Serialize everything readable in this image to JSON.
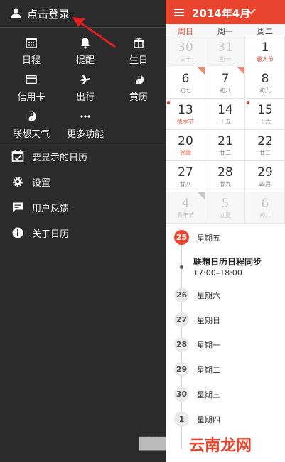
{
  "drawer": {
    "login_label": "点击登录",
    "grid": [
      {
        "label": "日程",
        "icon": "calendar-grid-icon"
      },
      {
        "label": "提醒",
        "icon": "bell-icon"
      },
      {
        "label": "生日",
        "icon": "gift-icon"
      },
      {
        "label": "信用卡",
        "icon": "credit-card-icon"
      },
      {
        "label": "出行",
        "icon": "airplane-icon"
      },
      {
        "label": "黄历",
        "icon": "yin-yang-icon"
      },
      {
        "label": "联想天气",
        "icon": "yin-yang-icon"
      },
      {
        "label": "更多功能",
        "icon": "more-dots-icon"
      }
    ],
    "menu": [
      {
        "label": "要显示的日历",
        "icon": "calendar-check-icon"
      },
      {
        "label": "设置",
        "icon": "gear-icon"
      },
      {
        "label": "用户反馈",
        "icon": "chat-bubble-icon"
      },
      {
        "label": "关于日历",
        "icon": "info-icon"
      }
    ]
  },
  "calendar": {
    "month_title": "2014年4月",
    "accent_color": "#e9452e",
    "weekdays": [
      "周日",
      "周一",
      "周二"
    ],
    "rows": [
      [
        {
          "d": "30",
          "l": "三十",
          "dim": true
        },
        {
          "d": "31",
          "l": "初一",
          "dim": true
        },
        {
          "d": "1",
          "l": "愚人节",
          "red_lunar": true
        }
      ],
      [
        {
          "d": "6",
          "l": "初七",
          "tag": true
        },
        {
          "d": "7",
          "l": "初八",
          "tag": true
        },
        {
          "d": "8",
          "l": "初九"
        }
      ],
      [
        {
          "d": "13",
          "l": "泼水节",
          "red_lunar": true,
          "dot": true
        },
        {
          "d": "14",
          "l": "十五"
        },
        {
          "d": "15",
          "l": "十六",
          "dot": true
        }
      ],
      [
        {
          "d": "20",
          "l": "谷雨",
          "red_lunar": true
        },
        {
          "d": "21",
          "l": "廿二"
        },
        {
          "d": "22",
          "l": "廿三"
        }
      ],
      [
        {
          "d": "27",
          "l": "廿八"
        },
        {
          "d": "28",
          "l": "廿九"
        },
        {
          "d": "29",
          "l": "四月"
        }
      ],
      [
        {
          "d": "4",
          "l": "青年节",
          "dim": true,
          "tag_grey": true
        },
        {
          "d": "5",
          "l": "立夏",
          "dim": true
        },
        {
          "d": "6",
          "l": "初八",
          "dim": true
        }
      ]
    ]
  },
  "agenda": {
    "today": {
      "num": "25",
      "weekday": "星期五"
    },
    "event": {
      "title": "联想日历日程同步",
      "time": "17:00–18:00"
    },
    "days": [
      {
        "num": "26",
        "weekday": "星期六"
      },
      {
        "num": "27",
        "weekday": "星期日"
      },
      {
        "num": "28",
        "weekday": "星期一"
      },
      {
        "num": "29",
        "weekday": "星期二"
      },
      {
        "num": "30",
        "weekday": "星期三"
      },
      {
        "num": "1",
        "weekday": "星期四"
      }
    ]
  },
  "watermark": {
    "text": "云南龙网"
  }
}
